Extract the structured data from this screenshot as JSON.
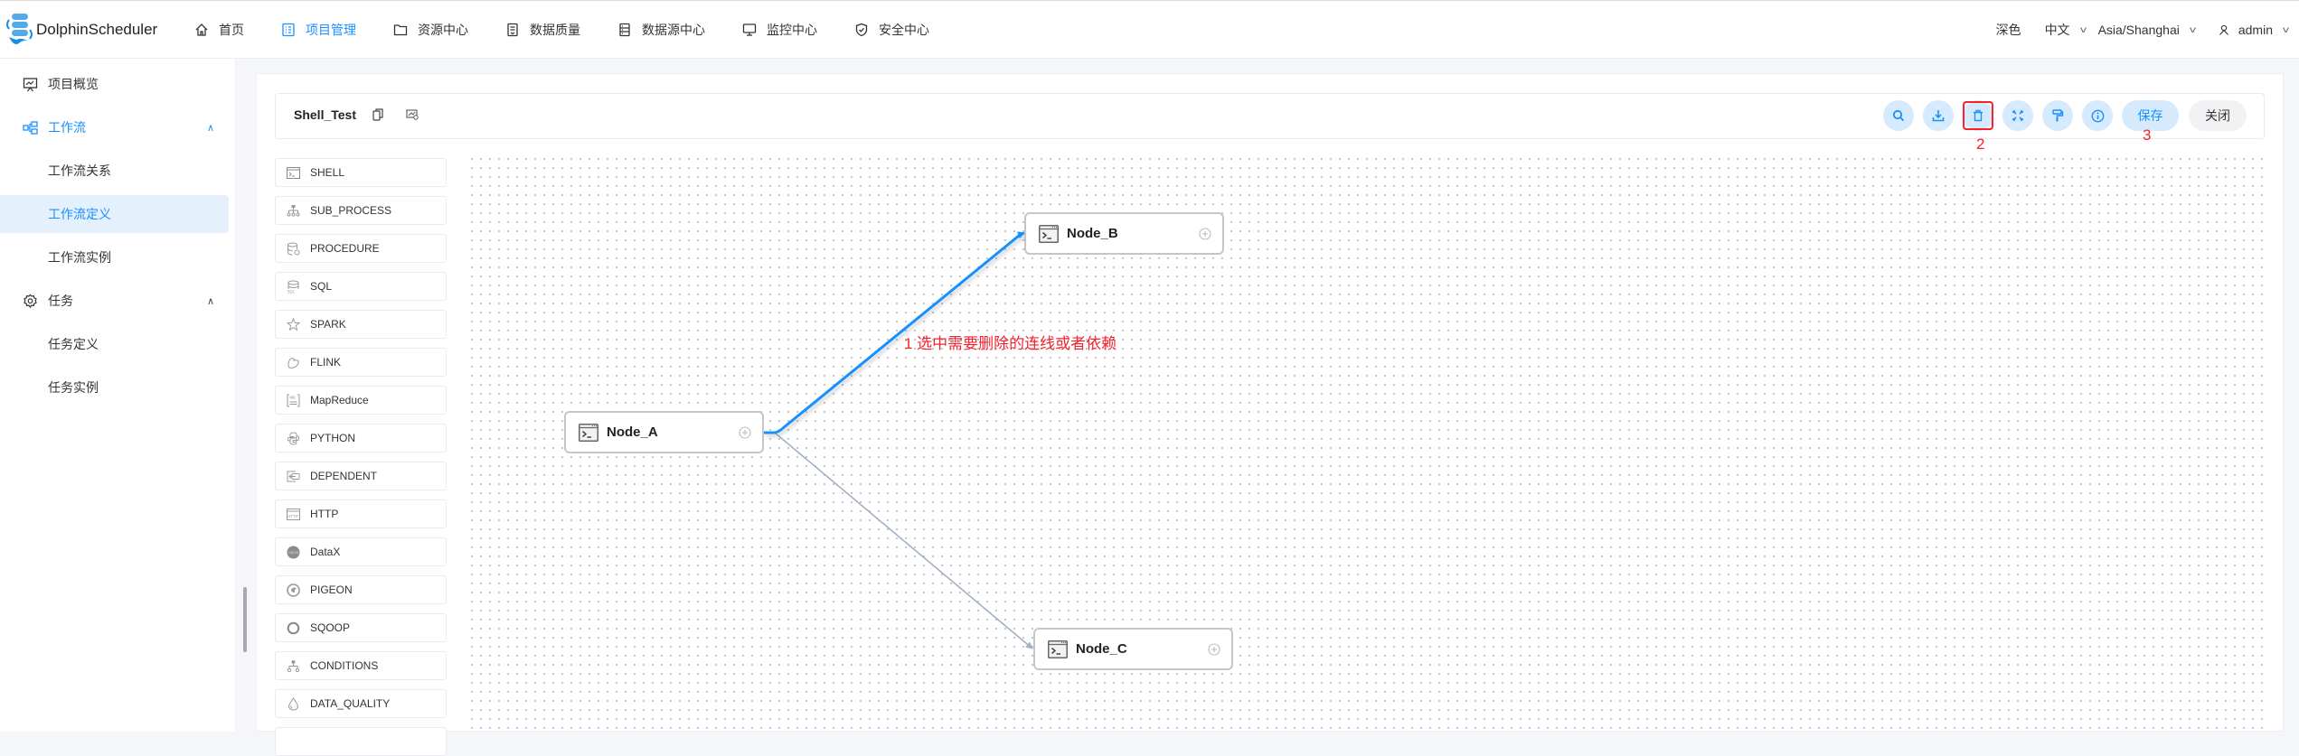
{
  "app": {
    "brand": "DolphinScheduler",
    "nav": [
      {
        "label": "首页",
        "icon": "home-icon"
      },
      {
        "label": "项目管理",
        "icon": "project-icon",
        "active": true
      },
      {
        "label": "资源中心",
        "icon": "folder-icon"
      },
      {
        "label": "数据质量",
        "icon": "document-icon"
      },
      {
        "label": "数据源中心",
        "icon": "datasource-icon"
      },
      {
        "label": "监控中心",
        "icon": "monitor-icon"
      },
      {
        "label": "安全中心",
        "icon": "shield-icon"
      }
    ],
    "right": {
      "theme": "深色",
      "language": "中文",
      "timezone": "Asia/Shanghai",
      "user": "admin"
    }
  },
  "sidebar": {
    "items": [
      {
        "label": "项目概览",
        "icon": "overview-icon"
      },
      {
        "label": "工作流",
        "icon": "workflow-icon",
        "expanded": true
      },
      {
        "label": "工作流关系"
      },
      {
        "label": "工作流定义",
        "selected": true
      },
      {
        "label": "工作流实例"
      },
      {
        "label": "任务",
        "icon": "gear-icon",
        "expanded": true
      },
      {
        "label": "任务定义"
      },
      {
        "label": "任务实例"
      }
    ]
  },
  "workflow": {
    "name": "Shell_Test",
    "toolbar": {
      "buttons": [
        "search",
        "download",
        "delete",
        "fullscreen",
        "format",
        "info"
      ],
      "save_label": "保存",
      "close_label": "关闭"
    }
  },
  "task_types": [
    {
      "label": "SHELL",
      "icon": "shell-icon"
    },
    {
      "label": "SUB_PROCESS",
      "icon": "sub-process-icon"
    },
    {
      "label": "PROCEDURE",
      "icon": "procedure-icon"
    },
    {
      "label": "SQL",
      "icon": "sql-icon"
    },
    {
      "label": "SPARK",
      "icon": "spark-icon"
    },
    {
      "label": "FLINK",
      "icon": "flink-icon"
    },
    {
      "label": "MapReduce",
      "icon": "mapreduce-icon"
    },
    {
      "label": "PYTHON",
      "icon": "python-icon"
    },
    {
      "label": "DEPENDENT",
      "icon": "dependent-icon"
    },
    {
      "label": "HTTP",
      "icon": "http-icon"
    },
    {
      "label": "DataX",
      "icon": "datax-icon"
    },
    {
      "label": "PIGEON",
      "icon": "pigeon-icon"
    },
    {
      "label": "SQOOP",
      "icon": "sqoop-icon"
    },
    {
      "label": "CONDITIONS",
      "icon": "conditions-icon"
    },
    {
      "label": "DATA_QUALITY",
      "icon": "data-quality-icon"
    }
  ],
  "dag": {
    "nodes": [
      {
        "id": "Node_A",
        "label": "Node_A"
      },
      {
        "id": "Node_B",
        "label": "Node_B"
      },
      {
        "id": "Node_C",
        "label": "Node_C"
      }
    ],
    "edges": [
      {
        "from": "Node_A",
        "to": "Node_B",
        "selected": true
      },
      {
        "from": "Node_A",
        "to": "Node_C",
        "selected": false
      }
    ],
    "colors": {
      "selected_edge": "#1890ff",
      "edge": "#a2b1c3"
    }
  },
  "annotations": {
    "step1": "1 选中需要删除的连线或者依赖",
    "step2": "2",
    "step3": "3",
    "color": "#f5222d"
  }
}
